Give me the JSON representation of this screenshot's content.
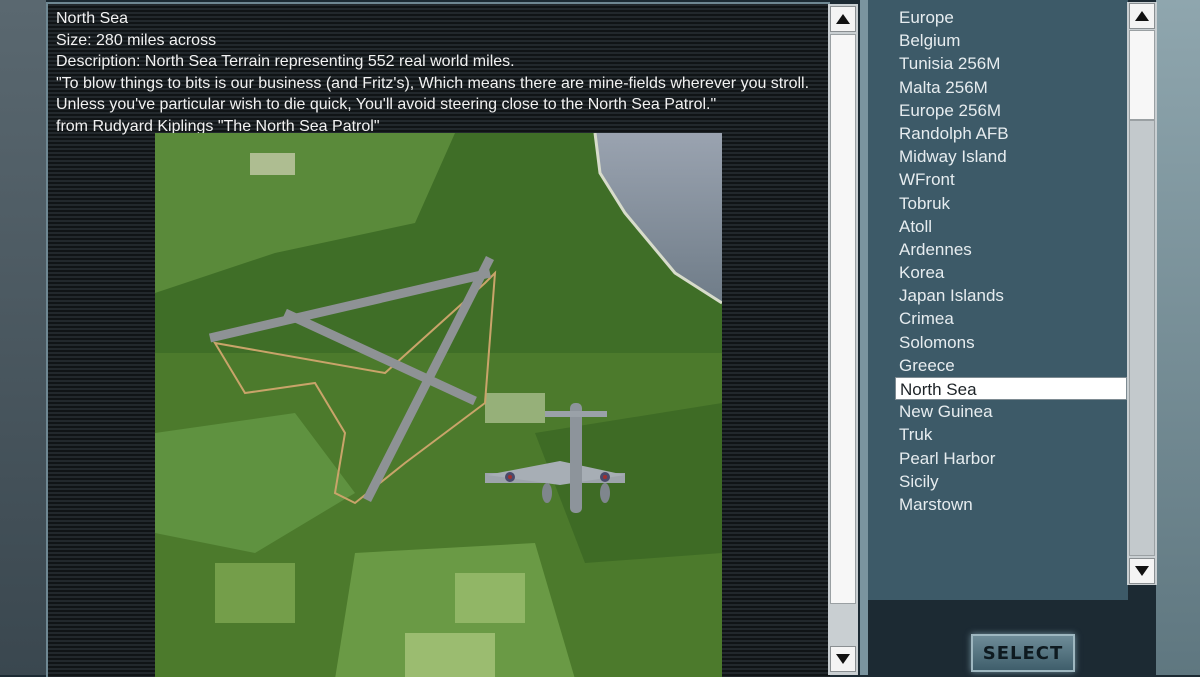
{
  "description": {
    "map_name": "North Sea",
    "size": "Size: 280 miles across",
    "desc": "Description: North Sea Terrain representing 552 real world miles.",
    "quote": "\"To blow things to bits is our business (and Fritz's), Which means there are mine-fields wherever you stroll. Unless you've particular wish to die quick, You'll avoid steering close to the North Sea Patrol.\"",
    "source": "from Rudyard Kiplings \"The North Sea Patrol\""
  },
  "preview": {
    "image": "aerial view of green terrain with airfield runways and a twin-engine aircraft in flight"
  },
  "map_list": {
    "items": [
      "Europe",
      "Belgium",
      "Tunisia 256M",
      "Malta 256M",
      "Europe 256M",
      "Randolph AFB",
      "Midway Island",
      "WFront",
      "Tobruk",
      "Atoll",
      "Ardennes",
      "Korea",
      "Japan Islands",
      "Crimea",
      "Solomons",
      "Greece",
      "North Sea",
      "New Guinea",
      "Truk",
      "Pearl Harbor",
      "Sicily",
      "Marstown"
    ],
    "selected": "North Sea"
  },
  "buttons": {
    "select_label": "SELECT"
  },
  "colors": {
    "panel_bg": "#101416",
    "list_bg": "#3d5a68",
    "selected_row": "#ffffff",
    "scrollbar_track": "#c9cfd2"
  }
}
